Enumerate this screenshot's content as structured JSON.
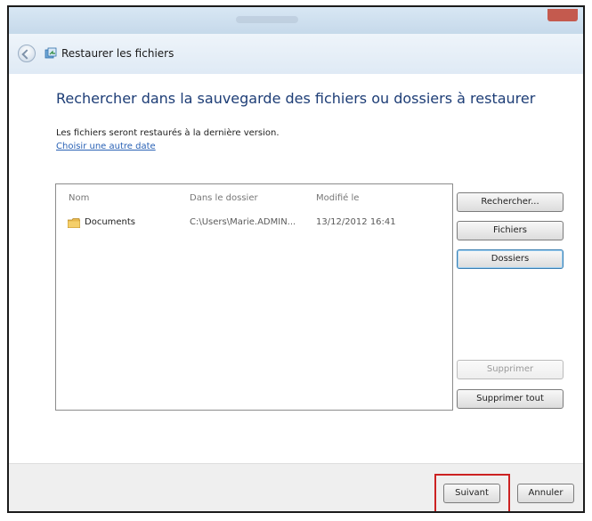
{
  "window": {
    "nav_title": "Restaurer les fichiers"
  },
  "content": {
    "heading": "Rechercher dans la sauvegarde des fichiers ou dossiers à restaurer",
    "info": "Les fichiers seront restaurés à la dernière version.",
    "link": "Choisir une autre date"
  },
  "list": {
    "columns": [
      "Nom",
      "Dans le dossier",
      "Modifié le"
    ],
    "rows": [
      {
        "name": "Documents",
        "folder": "C:\\Users\\Marie.ADMIN...",
        "modified": "13/12/2012 16:41"
      }
    ]
  },
  "buttons": {
    "search": "Rechercher...",
    "files": "Fichiers",
    "folders": "Dossiers",
    "delete": "Supprimer",
    "delete_all": "Supprimer tout"
  },
  "footer": {
    "next": "Suivant",
    "cancel": "Annuler"
  },
  "colors": {
    "heading": "#1d3d76",
    "link": "#2a62b5",
    "highlight": "#cc2222"
  },
  "icons": [
    "back-arrow-icon",
    "restore-files-icon",
    "folder-icon",
    "close-icon"
  ]
}
